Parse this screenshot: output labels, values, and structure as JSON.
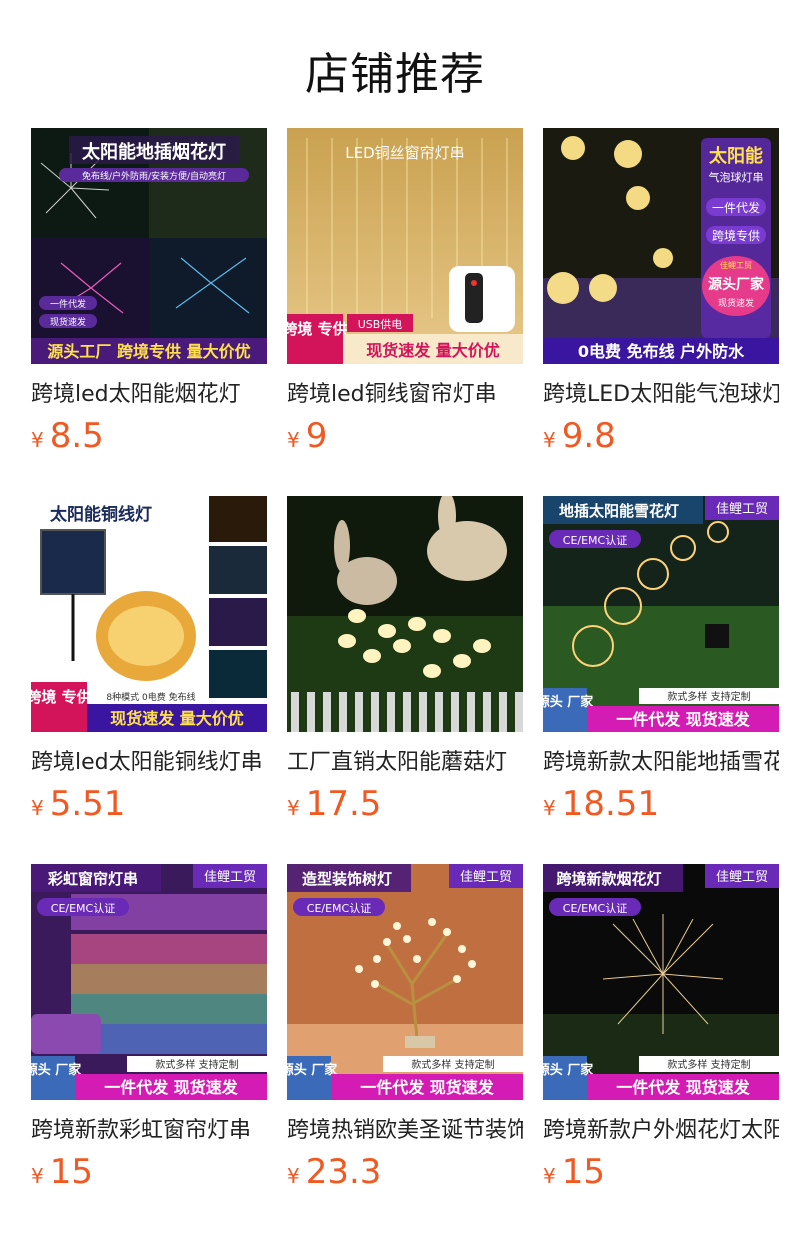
{
  "header": {
    "title": "店铺推荐"
  },
  "products": [
    {
      "name": "跨境led太阳能烟花灯",
      "currency": "¥",
      "price": "8.5",
      "overlay": {
        "top_label": "太阳能地插烟花灯",
        "sub_label": "免布线/户外防雨/安装方便/自动亮灯",
        "badges": [
          "一件代发",
          "现货速发"
        ],
        "bottom_bar": "源头工厂 跨境专供 量大价优"
      }
    },
    {
      "name": "跨境led铜线窗帘灯串",
      "currency": "¥",
      "price": "9",
      "overlay": {
        "top_label": "LED铜丝窗帘灯串",
        "corner_tag": "跨境 专供",
        "usb_label": "USB供电",
        "bottom_bar": "现货速发 量大价优"
      }
    },
    {
      "name": "跨境LED太阳能气泡球灯串",
      "currency": "¥",
      "price": "9.8",
      "overlay": {
        "top_label": "太阳能",
        "sub_label": "气泡球灯串",
        "badges": [
          "一件代发",
          "跨境专供"
        ],
        "seal_top": "佳鲤工贸",
        "seal_main": "源头厂家",
        "seal_bottom": "现货速发",
        "bottom_bar": "0电费 免布线 户外防水"
      }
    },
    {
      "name": "跨境led太阳能铜线灯串",
      "currency": "¥",
      "price": "5.51",
      "overlay": {
        "top_label": "太阳能铜线灯",
        "corner_tag": "跨境 专供",
        "mode_label": "8种模式 0电费 免布线",
        "bottom_bar": "现货速发 量大价优"
      }
    },
    {
      "name": "工厂直销太阳能蘑菇灯",
      "currency": "¥",
      "price": "17.5",
      "overlay": {}
    },
    {
      "name": "跨境新款太阳能地插雪花灯",
      "currency": "¥",
      "price": "18.51",
      "overlay": {
        "top_label": "地插太阳能雪花灯",
        "brand": "佳鲤工贸",
        "cert": "CE/EMC认证",
        "features": "款式多样 支持定制",
        "corner_tag": "源头 厂家",
        "bottom_bar": "一件代发 现货速发"
      }
    },
    {
      "name": "跨境新款彩虹窗帘灯串",
      "currency": "¥",
      "price": "15",
      "overlay": {
        "top_label": "彩虹窗帘灯串",
        "brand": "佳鲤工贸",
        "cert": "CE/EMC认证",
        "features": "款式多样 支持定制",
        "corner_tag": "源头 厂家",
        "bottom_bar": "一件代发 现货速发"
      }
    },
    {
      "name": "跨境热销欧美圣诞节装饰树灯",
      "currency": "¥",
      "price": "23.3",
      "overlay": {
        "top_label": "造型装饰树灯",
        "brand": "佳鲤工贸",
        "cert": "CE/EMC认证",
        "features": "款式多样 支持定制",
        "corner_tag": "源头 厂家",
        "bottom_bar": "一件代发 现货速发"
      }
    },
    {
      "name": "跨境新款户外烟花灯太阳能",
      "currency": "¥",
      "price": "15",
      "overlay": {
        "top_label": "跨境新款烟花灯",
        "brand": "佳鲤工贸",
        "cert": "CE/EMC认证",
        "features": "款式多样 支持定制",
        "corner_tag": "源头 厂家",
        "bottom_bar": "一件代发 现货速发"
      }
    }
  ]
}
